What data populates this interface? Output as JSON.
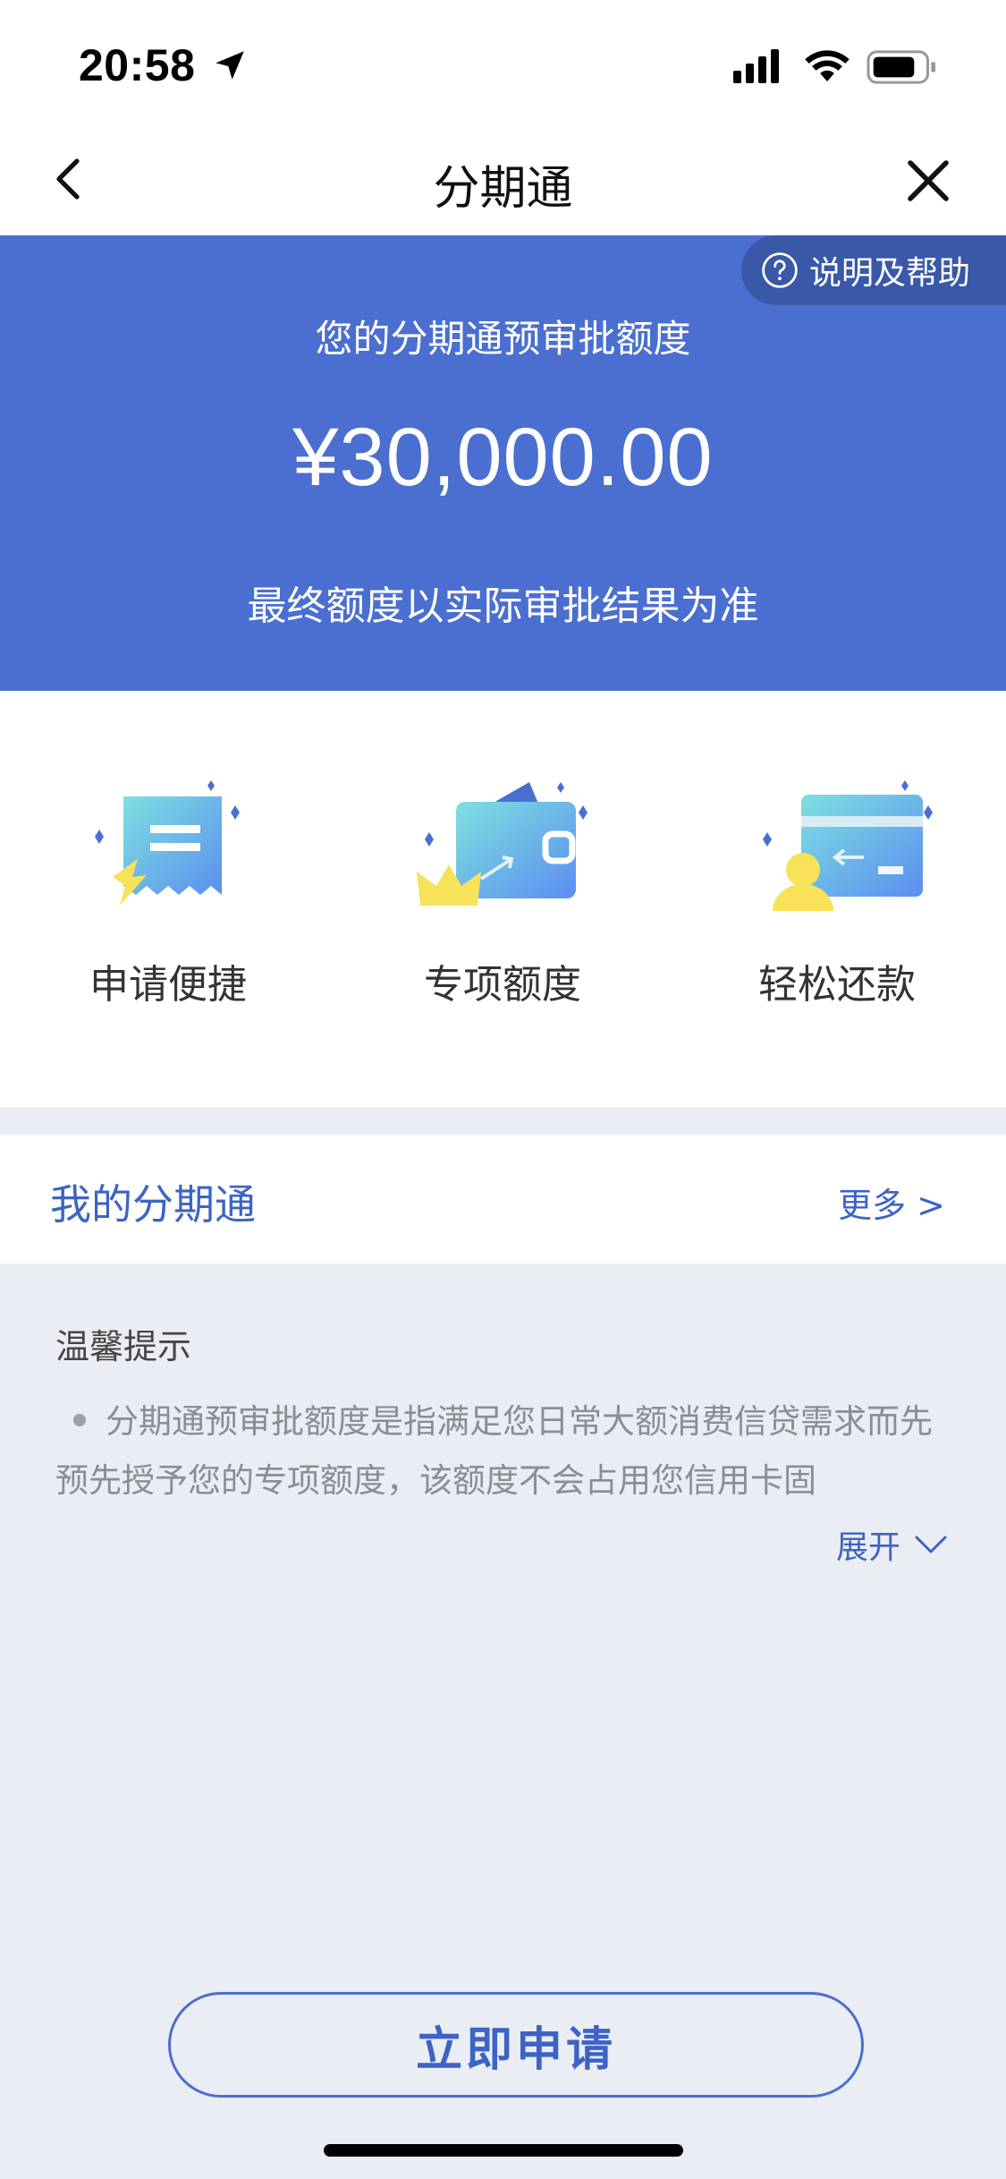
{
  "status_bar": {
    "time": "20:58",
    "icons": [
      "location-arrow-icon",
      "cellular-signal-icon",
      "wifi-icon",
      "battery-icon"
    ]
  },
  "nav": {
    "title": "分期通",
    "back_icon": "chevron-left-icon",
    "close_icon": "close-icon"
  },
  "banner": {
    "help_label": "说明及帮助",
    "subtitle": "您的分期通预审批额度",
    "amount": "¥30,000.00",
    "note": "最终额度以实际审批结果为准",
    "bg_color": "#4a6fd0"
  },
  "features": [
    {
      "label": "申请便捷",
      "icon": "fast-apply-icon"
    },
    {
      "label": "专项额度",
      "icon": "wallet-crown-icon"
    },
    {
      "label": "轻松还款",
      "icon": "card-repay-icon"
    }
  ],
  "my_section": {
    "title": "我的分期通",
    "more": "更多 >"
  },
  "tips": {
    "title": "温馨提示",
    "text": "分期通预审批额度是指满足您日常大额消费信贷需求而先预先授予您的专项额度，该额度不会占用您信用卡固",
    "expand": "展开"
  },
  "apply_button": "立即申请",
  "accent_color": "#3d63c4"
}
